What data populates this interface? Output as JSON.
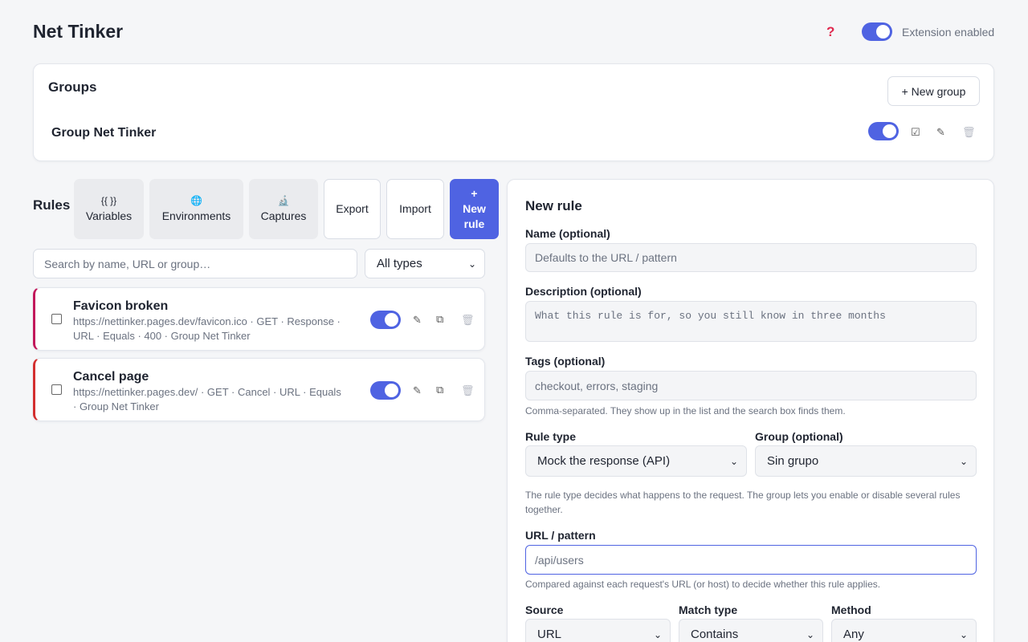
{
  "header": {
    "title": "Net Tinker",
    "help_icon": "question-icon",
    "extension_label": "Extension enabled",
    "extension_enabled": true
  },
  "colors": {
    "accent": "#4f63e2",
    "help": "#e0294f",
    "rule_border_1": "#c2185b",
    "rule_border_2": "#d32f2f"
  },
  "groups": {
    "title": "Groups",
    "new_group_label": "+ New group",
    "items": [
      {
        "name": "Group Net Tinker",
        "enabled": true
      }
    ]
  },
  "rules": {
    "title": "Rules",
    "toolbar": {
      "variables": {
        "icon": "{{ }}",
        "label": "Variables"
      },
      "environments": {
        "icon": "🌐",
        "label": "Environments"
      },
      "captures": {
        "icon": "🔬",
        "label": "Captures"
      },
      "export_label": "Export",
      "import_label": "Import",
      "new_rule_icon": "+",
      "new_rule_label": "New rule"
    },
    "search_placeholder": "Search by name, URL or group…",
    "type_filter": "All types",
    "items": [
      {
        "title": "Favicon broken",
        "meta": "https://nettinker.pages.dev/favicon.ico · GET · Response · URL · Equals · 400 · Group Net Tinker",
        "enabled": true
      },
      {
        "title": "Cancel page",
        "meta": "https://nettinker.pages.dev/ · GET · Cancel · URL · Equals · Group Net Tinker",
        "enabled": true
      }
    ]
  },
  "new_rule": {
    "title": "New rule",
    "name_label": "Name (optional)",
    "name_placeholder": "Defaults to the URL / pattern",
    "description_label": "Description (optional)",
    "description_placeholder": "What this rule is for, so you still know in three months",
    "tags_label": "Tags (optional)",
    "tags_placeholder": "checkout, errors, staging",
    "tags_help": "Comma-separated. They show up in the list and the search box finds them.",
    "rule_type_label": "Rule type",
    "rule_type_value": "Mock the response (API)",
    "group_label": "Group (optional)",
    "group_value": "Sin grupo",
    "type_help": "The rule type decides what happens to the request. The group lets you enable or disable several rules together.",
    "url_label": "URL / pattern",
    "url_placeholder": "/api/users",
    "url_help": "Compared against each request's URL (or host) to decide whether this rule applies.",
    "source_label": "Source",
    "source_value": "URL",
    "match_type_label": "Match type",
    "match_type_value": "Contains",
    "method_label": "Method",
    "method_value": "Any"
  }
}
